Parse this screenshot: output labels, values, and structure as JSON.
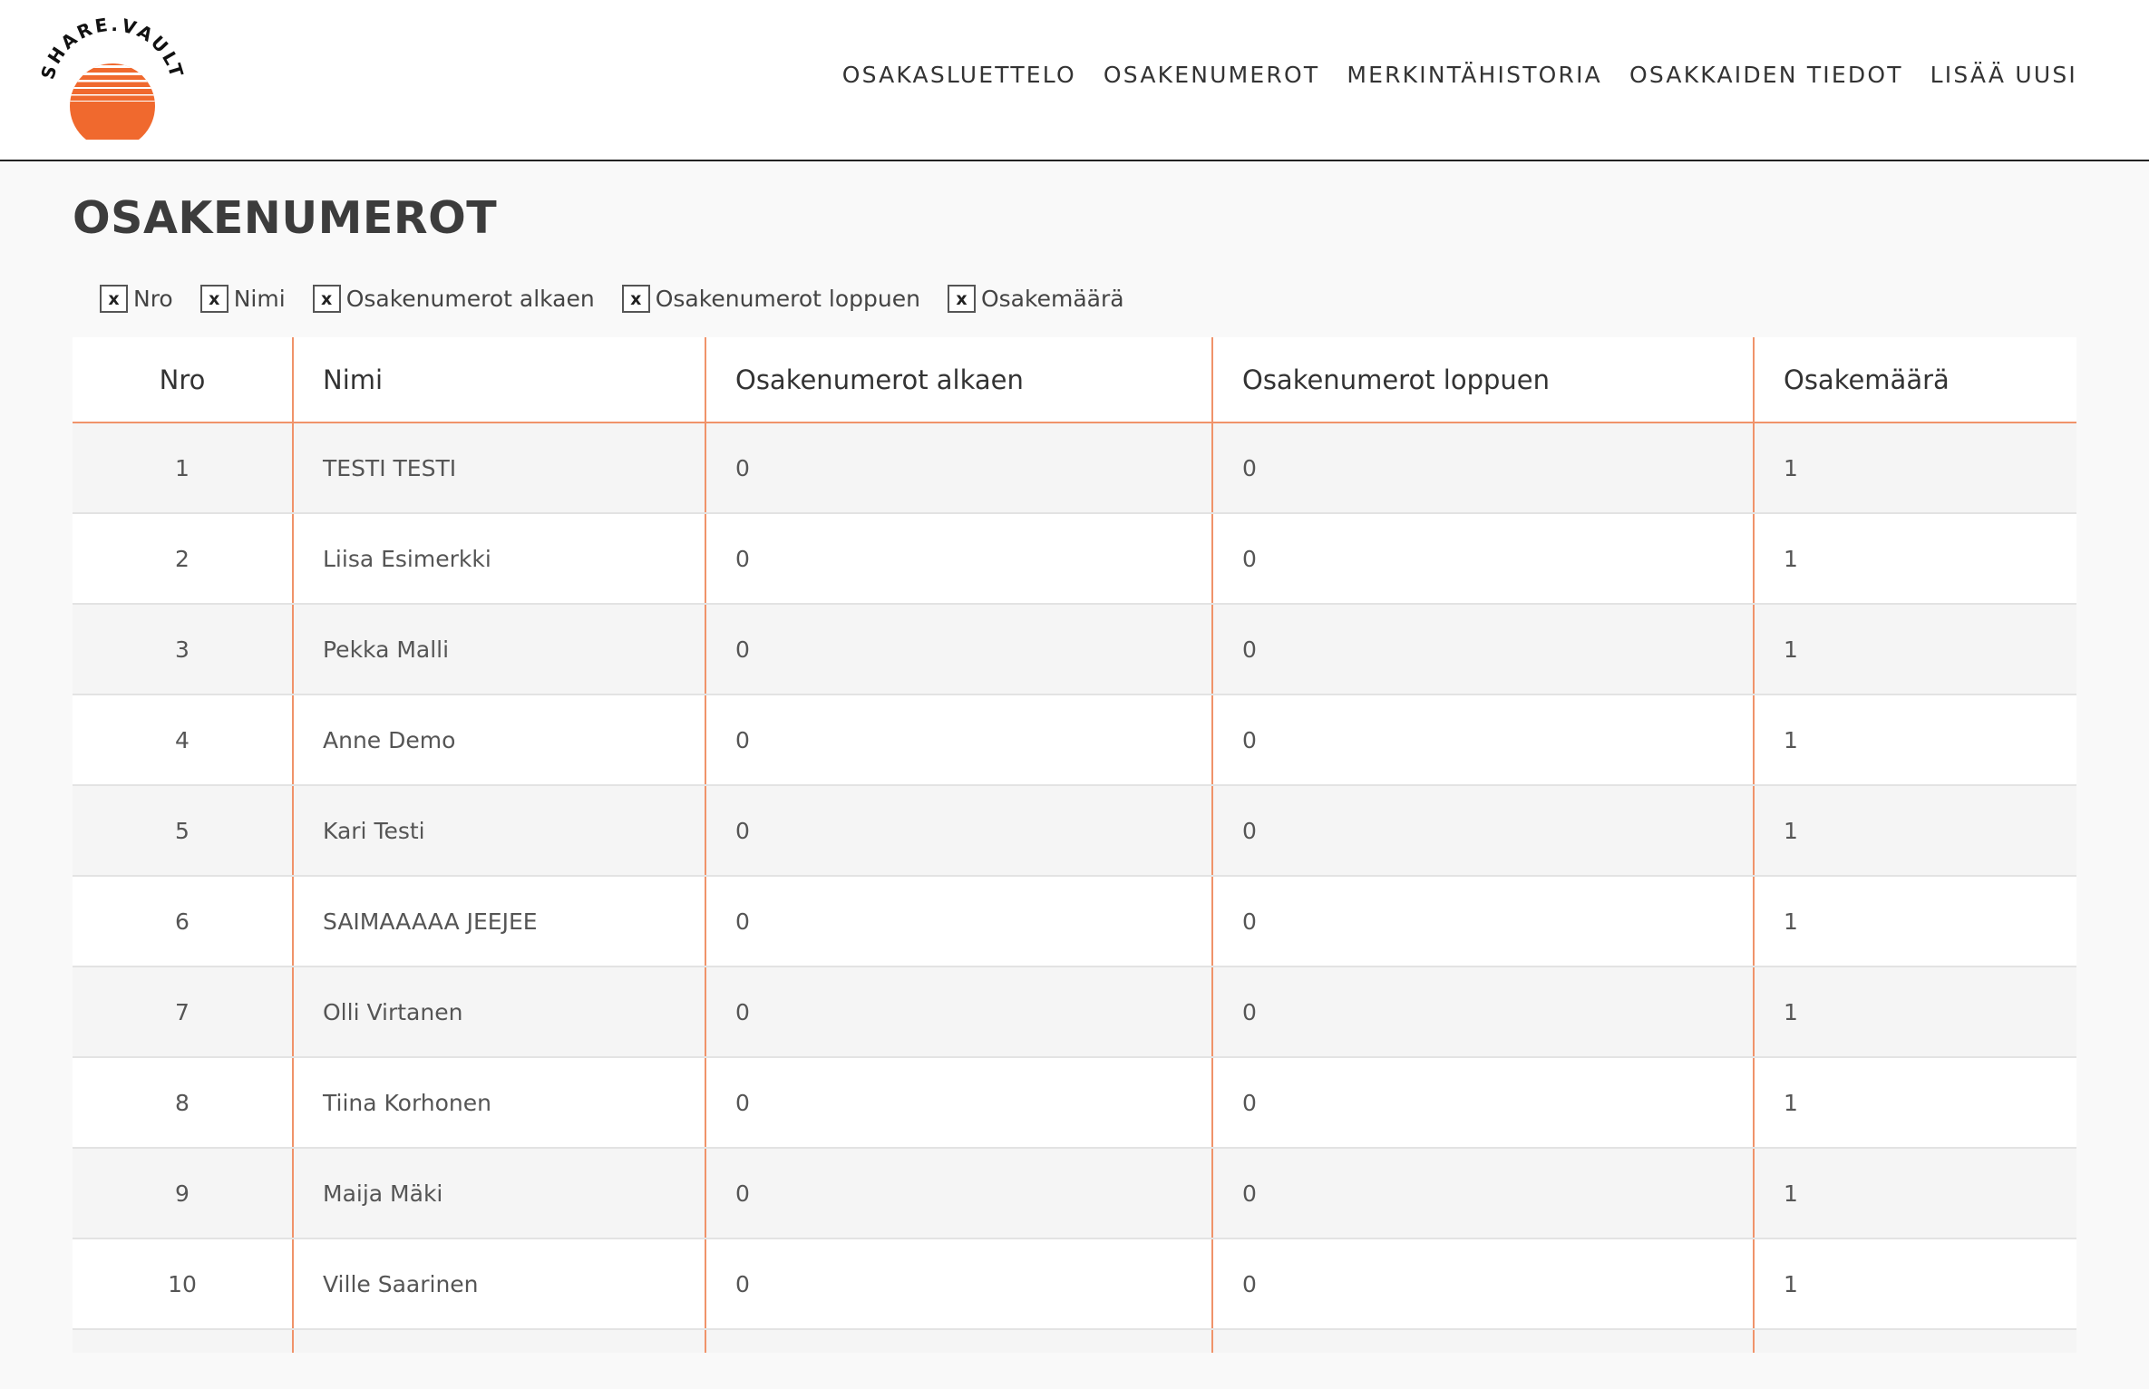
{
  "brand": {
    "logo_text": "SHARE.VAULT",
    "accent_color": "#f0692e",
    "border_color": "#f0936a"
  },
  "nav": {
    "items": [
      {
        "label": "OSAKASLUETTELO"
      },
      {
        "label": "OSAKENUMEROT"
      },
      {
        "label": "MERKINTÄHISTORIA"
      },
      {
        "label": "OSAKKAIDEN TIEDOT"
      },
      {
        "label": "LISÄÄ UUSI"
      }
    ]
  },
  "page": {
    "title": "OSAKENUMEROT"
  },
  "column_toggles": [
    {
      "mark": "x",
      "label": "Nro"
    },
    {
      "mark": "x",
      "label": "Nimi"
    },
    {
      "mark": "x",
      "label": "Osakenumerot alkaen"
    },
    {
      "mark": "x",
      "label": "Osakenumerot loppuen"
    },
    {
      "mark": "x",
      "label": "Osakemäärä"
    }
  ],
  "table": {
    "headers": [
      "Nro",
      "Nimi",
      "Osakenumerot alkaen",
      "Osakenumerot loppuen",
      "Osakemäärä"
    ],
    "rows": [
      [
        "1",
        "TESTI TESTI",
        "0",
        "0",
        "1"
      ],
      [
        "2",
        "Liisa Esimerkki",
        "0",
        "0",
        "1"
      ],
      [
        "3",
        "Pekka Malli",
        "0",
        "0",
        "1"
      ],
      [
        "4",
        "Anne Demo",
        "0",
        "0",
        "1"
      ],
      [
        "5",
        "Kari Testi",
        "0",
        "0",
        "1"
      ],
      [
        "6",
        "SAIMAAAAA JEEJEE",
        "0",
        "0",
        "1"
      ],
      [
        "7",
        "Olli Virtanen",
        "0",
        "0",
        "1"
      ],
      [
        "8",
        "Tiina Korhonen",
        "0",
        "0",
        "1"
      ],
      [
        "9",
        "Maija Mäki",
        "0",
        "0",
        "1"
      ],
      [
        "10",
        "Ville Saarinen",
        "0",
        "0",
        "1"
      ],
      [
        "",
        "",
        "",
        "",
        ""
      ]
    ]
  }
}
